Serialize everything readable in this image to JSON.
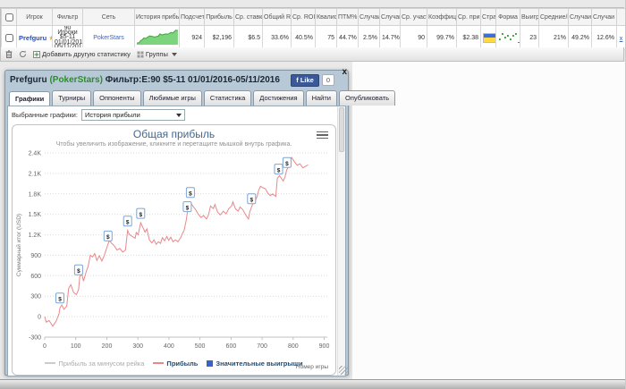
{
  "table": {
    "headers": [
      "",
      "Игрок",
      "Фильтр",
      "Сеть",
      "История прибыл",
      "Подсчет",
      "Прибыль",
      "Ср. ставка",
      "Общий ROI",
      "Ср. ROI",
      "Квалиф",
      "ПТМ%",
      "Случаи",
      "Случаи",
      "Ср. участь",
      "Коэффици",
      "Ср. при",
      "Стра",
      "Форма",
      "Выигр",
      "Средние/поз",
      "Случаи",
      "Случаи поз",
      ""
    ],
    "row": {
      "player": "Prefguru",
      "filter": "90\nИгроки\n$5-11\n01/01/201\n05/11/201",
      "network": "PokerStars",
      "count": "924",
      "profit": "$2,196",
      "avg_stake": "$6.5",
      "total_roi": "33.6%",
      "avg_roi": "40.5%",
      "qualified": "75",
      "itm_pct": "44.7%",
      "cases_a": "2.5%",
      "cases_b": "14.7%",
      "avg_entrants": "90",
      "coefficient": "99.7%",
      "avg_prize": "$2.38",
      "country": "ukraine-flag",
      "form_values": [
        1,
        4,
        2,
        3,
        1,
        3,
        4,
        -2
      ],
      "wins": "23",
      "avg_per_pos": "21%",
      "cases_c": "49.2%",
      "cases_pos": "12.6%",
      "action": "x"
    }
  },
  "toolbar": {
    "add_stats": "Добавить другую статистику",
    "groups": "Группы"
  },
  "popup": {
    "title_player": "Prefguru ",
    "title_network": "(PokerStars)",
    "title_rest": " Фильтр:E:90 $5-11 01/01/2016-05/11/2016",
    "fb_like": "Like",
    "fb_count": "0",
    "close": "x",
    "tabs": [
      "Графики",
      "Турниры",
      "Оппоненты",
      "Любимые игры",
      "Статистика",
      "Достижения",
      "Найти",
      "Опубликовать"
    ],
    "active_tab": "Графики",
    "selected_graphs_label": "Выбранные графики:",
    "graph_select_value": "История прибыли"
  },
  "chart_data": {
    "type": "line",
    "title": "Общая прибыль",
    "subtitle": "Чтобы увеличить изображение, кликните и перетащите мышкой внутрь графика.",
    "xlabel": "Номер игры",
    "ylabel": "Суммарный итог (USD)",
    "xlim": [
      0,
      910
    ],
    "ylim": [
      -300,
      2400
    ],
    "xticks": [
      0,
      100,
      200,
      300,
      400,
      500,
      600,
      700,
      800,
      900
    ],
    "yticks": [
      "2.4K",
      "2.1K",
      "1.8K",
      "1.5K",
      "1.2K",
      "900",
      "600",
      "300",
      "0",
      "-300"
    ],
    "ytick_values": [
      2400,
      2100,
      1800,
      1500,
      1200,
      900,
      600,
      300,
      0,
      -300
    ],
    "grid": "dotted",
    "legend_position": "bottom-center",
    "legend": [
      {
        "label": "Прибыль за минусом рейка",
        "type": "line",
        "color": "#cccccc",
        "disabled": true
      },
      {
        "label": "Прибыль",
        "type": "line",
        "color": "#e8888a",
        "disabled": false
      },
      {
        "label": "Значительные выигрыши",
        "type": "square",
        "color": "#3566c4",
        "disabled": false
      }
    ],
    "series": [
      {
        "name": "Прибыль",
        "color": "#e8888a",
        "points": [
          [
            0,
            0
          ],
          [
            5,
            -80
          ],
          [
            14,
            -56
          ],
          [
            26,
            -140
          ],
          [
            37,
            -64
          ],
          [
            46,
            42
          ],
          [
            49,
            126
          ],
          [
            55,
            172
          ],
          [
            62,
            107
          ],
          [
            71,
            156
          ],
          [
            77,
            412
          ],
          [
            84,
            469
          ],
          [
            93,
            355
          ],
          [
            102,
            324
          ],
          [
            109,
            400
          ],
          [
            113,
            588
          ],
          [
            120,
            619
          ],
          [
            125,
            520
          ],
          [
            134,
            665
          ],
          [
            140,
            740
          ],
          [
            147,
            901
          ],
          [
            154,
            874
          ],
          [
            161,
            924
          ],
          [
            168,
            824
          ],
          [
            176,
            893
          ],
          [
            184,
            816
          ],
          [
            192,
            901
          ],
          [
            201,
            1027
          ],
          [
            208,
            1115
          ],
          [
            215,
            1077
          ],
          [
            224,
            1039
          ],
          [
            233,
            977
          ],
          [
            242,
            1000
          ],
          [
            251,
            947
          ],
          [
            260,
            977
          ],
          [
            267,
            1263
          ],
          [
            273,
            1202
          ],
          [
            282,
            1176
          ],
          [
            291,
            1149
          ],
          [
            295,
            1233
          ],
          [
            301,
            1202
          ],
          [
            309,
            1378
          ],
          [
            316,
            1309
          ],
          [
            323,
            1240
          ],
          [
            329,
            1286
          ],
          [
            337,
            1126
          ],
          [
            345,
            1080
          ],
          [
            352,
            1126
          ],
          [
            359,
            1061
          ],
          [
            366,
            1099
          ],
          [
            373,
            1073
          ],
          [
            379,
            1157
          ],
          [
            386,
            1111
          ],
          [
            393,
            1176
          ],
          [
            399,
            1118
          ],
          [
            406,
            1164
          ],
          [
            413,
            1099
          ],
          [
            421,
            1126
          ],
          [
            429,
            1099
          ],
          [
            438,
            1157
          ],
          [
            444,
            1225
          ],
          [
            449,
            1263
          ],
          [
            456,
            1416
          ],
          [
            463,
            1653
          ],
          [
            469,
            1672
          ],
          [
            477,
            1622
          ],
          [
            486,
            1569
          ],
          [
            494,
            1508
          ],
          [
            503,
            1454
          ],
          [
            512,
            1481
          ],
          [
            521,
            1431
          ],
          [
            528,
            1500
          ],
          [
            534,
            1622
          ],
          [
            543,
            1584
          ],
          [
            548,
            1645
          ],
          [
            557,
            1530
          ],
          [
            566,
            1492
          ],
          [
            575,
            1546
          ],
          [
            584,
            1508
          ],
          [
            593,
            1584
          ],
          [
            602,
            1622
          ],
          [
            606,
            1683
          ],
          [
            614,
            1584
          ],
          [
            623,
            1546
          ],
          [
            629,
            1607
          ],
          [
            638,
            1569
          ],
          [
            647,
            1492
          ],
          [
            656,
            1431
          ],
          [
            660,
            1530
          ],
          [
            666,
            1607
          ],
          [
            671,
            1668
          ],
          [
            678,
            1699
          ],
          [
            684,
            1760
          ],
          [
            689,
            1852
          ],
          [
            695,
            1913
          ],
          [
            702,
            1890
          ],
          [
            711,
            1874
          ],
          [
            718,
            1813
          ],
          [
            726,
            1775
          ],
          [
            734,
            1798
          ],
          [
            744,
            1760
          ],
          [
            749,
            2028
          ],
          [
            756,
            2066
          ],
          [
            762,
            2028
          ],
          [
            768,
            1989
          ],
          [
            774,
            2051
          ],
          [
            779,
            2150
          ],
          [
            785,
            2196
          ],
          [
            790,
            2272
          ],
          [
            795,
            2333
          ],
          [
            804,
            2272
          ],
          [
            813,
            2219
          ],
          [
            822,
            2242
          ],
          [
            831,
            2181
          ],
          [
            840,
            2203
          ],
          [
            848,
            2226
          ]
        ]
      }
    ],
    "markers": {
      "name": "Значительные выигрыши",
      "symbol": "$",
      "points": [
        [
          49,
          267
        ],
        [
          109,
          679
        ],
        [
          204,
          1176
        ],
        [
          267,
          1393
        ],
        [
          309,
          1508
        ],
        [
          459,
          1606
        ],
        [
          469,
          1813
        ],
        [
          666,
          1721
        ],
        [
          753,
          2156
        ],
        [
          780,
          2252
        ]
      ]
    }
  }
}
